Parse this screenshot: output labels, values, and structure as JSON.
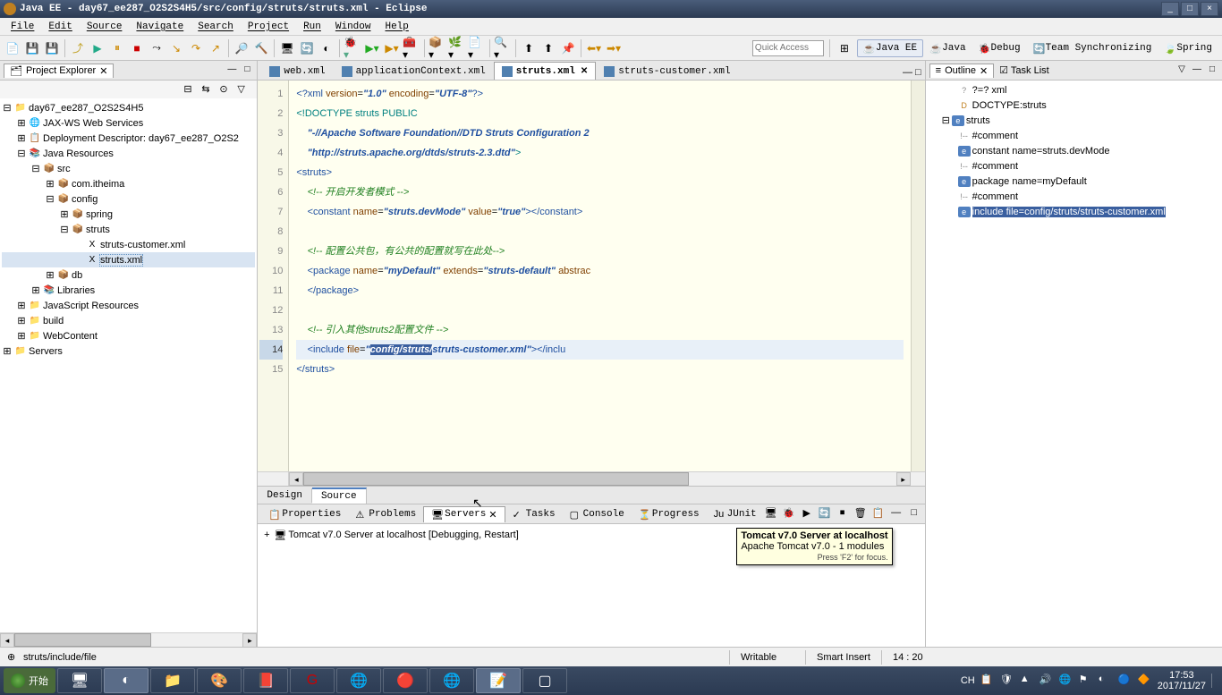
{
  "title": "Java EE - day67_ee287_O2S2S4H5/src/config/struts/struts.xml - Eclipse",
  "menu": [
    "File",
    "Edit",
    "Source",
    "Navigate",
    "Search",
    "Project",
    "Run",
    "Window",
    "Help"
  ],
  "quick_access_placeholder": "Quick Access",
  "perspectives": [
    {
      "label": "Java EE",
      "active": true,
      "icon": "☕"
    },
    {
      "label": "Java",
      "icon": "☕"
    },
    {
      "label": "Debug",
      "icon": "🐞"
    },
    {
      "label": "Team Synchronizing",
      "icon": "🔄"
    },
    {
      "label": "Spring",
      "icon": "🍃"
    }
  ],
  "pe": {
    "title": "Project Explorer",
    "tree": [
      {
        "l": 0,
        "exp": "-",
        "icon": "📁",
        "label": "day67_ee287_O2S2S4H5"
      },
      {
        "l": 1,
        "exp": "+",
        "icon": "🌐",
        "label": "JAX-WS Web Services"
      },
      {
        "l": 1,
        "exp": "+",
        "icon": "📋",
        "label": "Deployment Descriptor: day67_ee287_O2S2"
      },
      {
        "l": 1,
        "exp": "-",
        "icon": "📚",
        "label": "Java Resources"
      },
      {
        "l": 2,
        "exp": "-",
        "icon": "📦",
        "label": "src"
      },
      {
        "l": 3,
        "exp": "+",
        "icon": "📦",
        "label": "com.itheima"
      },
      {
        "l": 3,
        "exp": "-",
        "icon": "📦",
        "label": "config"
      },
      {
        "l": 4,
        "exp": "+",
        "icon": "📦",
        "label": "spring"
      },
      {
        "l": 4,
        "exp": "-",
        "icon": "📦",
        "label": "struts"
      },
      {
        "l": 5,
        "exp": "",
        "icon": "X",
        "label": "struts-customer.xml"
      },
      {
        "l": 5,
        "exp": "",
        "icon": "X",
        "label": "struts.xml",
        "sel": true
      },
      {
        "l": 3,
        "exp": "+",
        "icon": "📦",
        "label": "db"
      },
      {
        "l": 2,
        "exp": "+",
        "icon": "📚",
        "label": "Libraries"
      },
      {
        "l": 1,
        "exp": "+",
        "icon": "📁",
        "label": "JavaScript Resources"
      },
      {
        "l": 1,
        "exp": "+",
        "icon": "📁",
        "label": "build"
      },
      {
        "l": 1,
        "exp": "+",
        "icon": "📁",
        "label": "WebContent"
      },
      {
        "l": 0,
        "exp": "+",
        "icon": "📁",
        "label": "Servers"
      }
    ]
  },
  "editor_tabs": [
    {
      "label": "web.xml"
    },
    {
      "label": "applicationContext.xml"
    },
    {
      "label": "struts.xml",
      "active": true,
      "close": true
    },
    {
      "label": "struts-customer.xml"
    }
  ],
  "editor": {
    "active_bottom": "Source",
    "bottom_tabs": [
      "Design",
      "Source"
    ],
    "lines": [
      {
        "n": 1,
        "html": "<span class='c2'>&lt;?xml</span> <span class='c3'>version</span>=<span class='c4'>\"1.0\"</span> <span class='c3'>encoding</span>=<span class='c4'>\"UTF-8\"</span><span class='c2'>?&gt;</span>"
      },
      {
        "n": 2,
        "html": "<span class='c5'>&lt;!DOCTYPE struts PUBLIC</span>"
      },
      {
        "n": 3,
        "html": "    <span class='c4'>\"-//Apache Software Foundation//DTD Struts Configuration 2</span>"
      },
      {
        "n": 4,
        "html": "    <span class='c4'>\"http://struts.apache.org/dtds/struts-2.3.dtd\"</span><span class='c5'>&gt;</span>"
      },
      {
        "n": 5,
        "html": "<span class='c2'>&lt;struts&gt;</span>"
      },
      {
        "n": 6,
        "html": "    <span class='c1'>&lt;!-- 开启开发者模式 --&gt;</span>"
      },
      {
        "n": 7,
        "html": "    <span class='c2'>&lt;constant</span> <span class='c3'>name</span>=<span class='c4'>\"struts.devMode\"</span> <span class='c3'>value</span>=<span class='c4'>\"true\"</span><span class='c2'>&gt;&lt;/constant&gt;</span>"
      },
      {
        "n": 8,
        "html": ""
      },
      {
        "n": 9,
        "html": "    <span class='c1'>&lt;!-- 配置公共包，有公共的配置就写在此处--&gt;</span>"
      },
      {
        "n": 10,
        "html": "    <span class='c2'>&lt;package</span> <span class='c3'>name</span>=<span class='c4'>\"myDefault\"</span> <span class='c3'>extends</span>=<span class='c4'>\"struts-default\"</span> <span class='c3'>abstrac</span>"
      },
      {
        "n": 11,
        "html": "    <span class='c2'>&lt;/package&gt;</span>"
      },
      {
        "n": 12,
        "html": ""
      },
      {
        "n": 13,
        "html": "    <span class='c1'>&lt;!-- 引入其他struts2配置文件 --&gt;</span>"
      },
      {
        "n": 14,
        "cur": true,
        "html": "    <span class='c2'>&lt;include</span> <span class='c3'>file</span>=<span class='c4'>\"</span><span class='sel-hl'>config/struts/</span><span class='c4'>struts-customer.xml\"</span><span class='c2'>&gt;&lt;/inclu</span>"
      },
      {
        "n": 15,
        "html": "<span class='c2'>&lt;/struts&gt;</span>"
      }
    ]
  },
  "bottom_views": [
    {
      "label": "Properties",
      "icon": "📋"
    },
    {
      "label": "Problems",
      "icon": "⚠"
    },
    {
      "label": "Servers",
      "icon": "🖥",
      "active": true,
      "close": true
    },
    {
      "label": "Tasks",
      "icon": "✓"
    },
    {
      "label": "Console",
      "icon": "▢"
    },
    {
      "label": "Progress",
      "icon": "⏳"
    },
    {
      "label": "JUnit",
      "icon": "Ju"
    }
  ],
  "server": {
    "label": "Tomcat v7.0 Server at localhost  [Debugging, Restart]",
    "tooltip_title": "Tomcat v7.0 Server at localhost",
    "tooltip_desc": "Apache Tomcat v7.0 - 1 modules",
    "tooltip_hint": "Press 'F2' for focus."
  },
  "outline": {
    "title": "Outline",
    "task_list": "Task List",
    "items": [
      {
        "l": 1,
        "icon": "xml",
        "label": "?=? xml"
      },
      {
        "l": 1,
        "icon": "doc",
        "label": "DOCTYPE:struts"
      },
      {
        "l": 0,
        "exp": "-",
        "icon": "el",
        "label": "struts"
      },
      {
        "l": 1,
        "icon": "cm",
        "label": "#comment"
      },
      {
        "l": 1,
        "icon": "el",
        "label": "constant name=struts.devMode"
      },
      {
        "l": 1,
        "icon": "cm",
        "label": "#comment"
      },
      {
        "l": 1,
        "icon": "el",
        "label": "package name=myDefault"
      },
      {
        "l": 1,
        "icon": "cm",
        "label": "#comment"
      },
      {
        "l": 1,
        "icon": "el",
        "label": "include file=config/struts/struts-customer.xml",
        "sel": true
      }
    ]
  },
  "status": {
    "path": "struts/include/file",
    "writable": "Writable",
    "insert": "Smart Insert",
    "pos": "14 : 20"
  },
  "taskbar": {
    "start": "开始",
    "ime": "CH",
    "time": "17:53",
    "date": "2017/11/27"
  }
}
